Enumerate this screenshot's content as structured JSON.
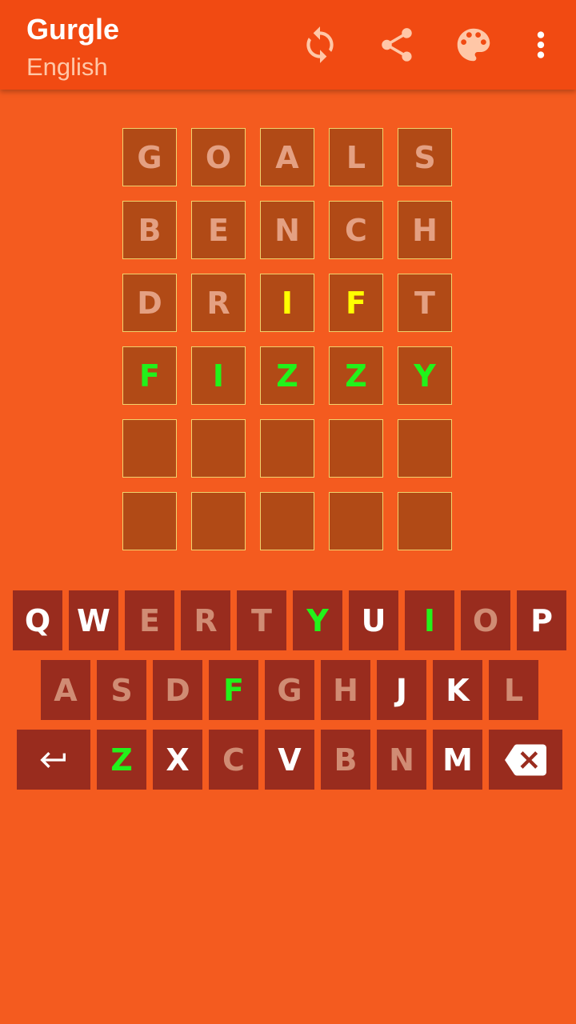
{
  "app": {
    "title": "Gurgle",
    "subtitle": "English"
  },
  "actions": [
    {
      "name": "refresh-icon"
    },
    {
      "name": "share-icon"
    },
    {
      "name": "palette-icon"
    },
    {
      "name": "more-vert-icon"
    }
  ],
  "colors": {
    "background": "#f45b1f",
    "appbar": "#f14a12",
    "tile": "#b14a16",
    "tile_border": "#f1d36c",
    "key": "#992c1e",
    "correct": "#22f21a",
    "present": "#ffff00",
    "absent_tile_letter": "#e4a082",
    "absent_key_letter": "#d08c74",
    "unused_key_letter": "#ffffff"
  },
  "board": [
    [
      {
        "letter": "G",
        "state": "absent"
      },
      {
        "letter": "O",
        "state": "absent"
      },
      {
        "letter": "A",
        "state": "absent"
      },
      {
        "letter": "L",
        "state": "absent"
      },
      {
        "letter": "S",
        "state": "absent"
      }
    ],
    [
      {
        "letter": "B",
        "state": "absent"
      },
      {
        "letter": "E",
        "state": "absent"
      },
      {
        "letter": "N",
        "state": "absent"
      },
      {
        "letter": "C",
        "state": "absent"
      },
      {
        "letter": "H",
        "state": "absent"
      }
    ],
    [
      {
        "letter": "D",
        "state": "absent"
      },
      {
        "letter": "R",
        "state": "absent"
      },
      {
        "letter": "I",
        "state": "present"
      },
      {
        "letter": "F",
        "state": "present"
      },
      {
        "letter": "T",
        "state": "absent"
      }
    ],
    [
      {
        "letter": "F",
        "state": "correct"
      },
      {
        "letter": "I",
        "state": "correct"
      },
      {
        "letter": "Z",
        "state": "correct"
      },
      {
        "letter": "Z",
        "state": "correct"
      },
      {
        "letter": "Y",
        "state": "correct"
      }
    ],
    [
      {
        "letter": "",
        "state": "empty"
      },
      {
        "letter": "",
        "state": "empty"
      },
      {
        "letter": "",
        "state": "empty"
      },
      {
        "letter": "",
        "state": "empty"
      },
      {
        "letter": "",
        "state": "empty"
      }
    ],
    [
      {
        "letter": "",
        "state": "empty"
      },
      {
        "letter": "",
        "state": "empty"
      },
      {
        "letter": "",
        "state": "empty"
      },
      {
        "letter": "",
        "state": "empty"
      },
      {
        "letter": "",
        "state": "empty"
      }
    ]
  ],
  "keyboard": [
    [
      {
        "label": "Q",
        "state": "unused"
      },
      {
        "label": "W",
        "state": "unused"
      },
      {
        "label": "E",
        "state": "absent"
      },
      {
        "label": "R",
        "state": "absent"
      },
      {
        "label": "T",
        "state": "absent"
      },
      {
        "label": "Y",
        "state": "correct"
      },
      {
        "label": "U",
        "state": "unused"
      },
      {
        "label": "I",
        "state": "correct"
      },
      {
        "label": "O",
        "state": "absent"
      },
      {
        "label": "P",
        "state": "unused"
      }
    ],
    [
      {
        "label": "A",
        "state": "absent"
      },
      {
        "label": "S",
        "state": "absent"
      },
      {
        "label": "D",
        "state": "absent"
      },
      {
        "label": "F",
        "state": "correct"
      },
      {
        "label": "G",
        "state": "absent"
      },
      {
        "label": "H",
        "state": "absent"
      },
      {
        "label": "J",
        "state": "unused"
      },
      {
        "label": "K",
        "state": "unused"
      },
      {
        "label": "L",
        "state": "absent"
      }
    ],
    [
      {
        "label": "",
        "state": "unused",
        "icon": "enter-icon"
      },
      {
        "label": "Z",
        "state": "correct"
      },
      {
        "label": "X",
        "state": "unused"
      },
      {
        "label": "C",
        "state": "absent"
      },
      {
        "label": "V",
        "state": "unused"
      },
      {
        "label": "B",
        "state": "absent"
      },
      {
        "label": "N",
        "state": "absent"
      },
      {
        "label": "M",
        "state": "unused"
      },
      {
        "label": "",
        "state": "unused",
        "icon": "backspace-icon"
      }
    ]
  ]
}
